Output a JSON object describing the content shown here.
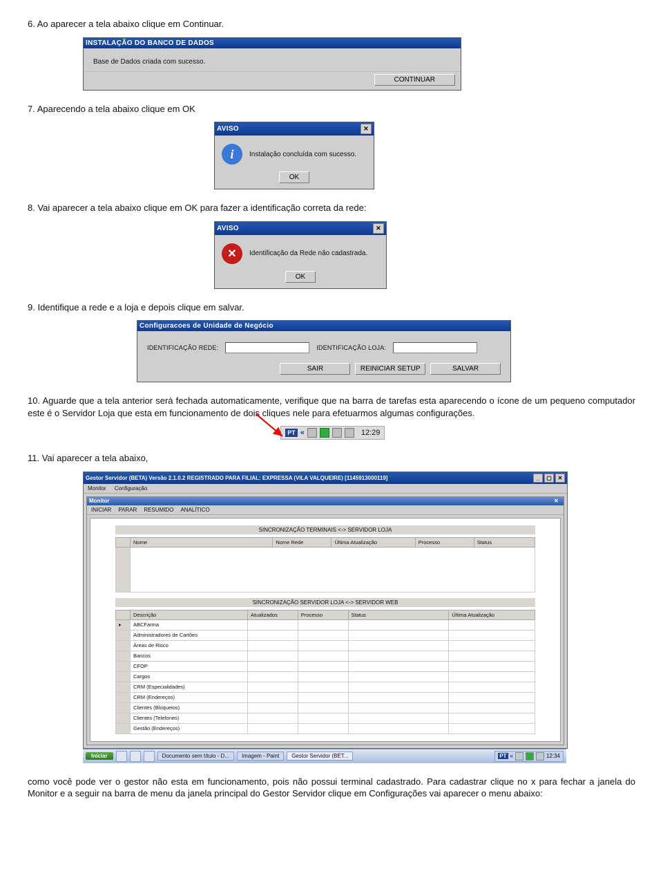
{
  "step6": {
    "text": "6. Ao aparecer a tela abaixo clique em Continuar."
  },
  "fig1": {
    "title": "INSTALAÇÃO DO BANCO DE DADOS",
    "body_text": "Base de Dados criada com sucesso.",
    "continuar_label": "CONTINUAR"
  },
  "step7": {
    "text": "7. Aparecendo a tela abaixo clique em OK"
  },
  "fig2": {
    "title": "AVISO",
    "msg": "Instalação concluída com sucesso.",
    "ok_label": "OK"
  },
  "step8": {
    "text": "8. Vai aparecer a tela abaixo clique em OK para fazer a identificação correta da rede:"
  },
  "fig3": {
    "title": "AVISO",
    "msg": "Identificação da Rede não cadastrada.",
    "ok_label": "OK"
  },
  "step9": {
    "text": "9. Identifique a rede e a loja e depois clique em salvar."
  },
  "fig4": {
    "title": "Configuracoes de Unidade de Negócio",
    "label_rede": "IDENTIFICAÇÃO REDE:",
    "label_loja": "IDENTIFICAÇÃO LOJA:",
    "btn_sair": "SAIR",
    "btn_reiniciar": "REINICIAR SETUP",
    "btn_salvar": "SALVAR"
  },
  "step10": {
    "text": "10. Aguarde que a tela anterior será fechada automaticamente, verifique que na barra de tarefas esta aparecendo o ícone de um pequeno computador este é o Servidor Loja que esta em funcionamento de dois cliques nele para efetuarmos algumas configurações."
  },
  "fig5": {
    "lang": "PT",
    "clock": "12:29"
  },
  "step11": {
    "text": "11. Vai aparecer a tela abaixo,"
  },
  "fig6": {
    "title": "Gestor Servidor (BETA) Versão 2.1.0.2 REGISTRADO PARA FILIAL: EXPRESSA (VILA VALQUEIRE) [1145913000119]",
    "menus": [
      "Monitor",
      "Configuração"
    ],
    "inner_title": "Monitor",
    "toolbar": [
      "INICIAR",
      "PARAR",
      "RESUMIDO",
      "ANALÍTICO"
    ],
    "sect1_title": "SINCRONIZAÇÃO TERMINAIS <-> SERVIDOR LOJA",
    "tbl1_headers": [
      "Nome",
      "Nome Rede",
      "Última Atualização",
      "Processo",
      "Status"
    ],
    "sect2_title": "SINCRONIZAÇÃO SERVIDOR LOJA <-> SERVIDOR WEB",
    "tbl2_headers": [
      "Descrição",
      "Atualizados",
      "Processo",
      "Status",
      "Última Atualização"
    ],
    "tbl2_rows": [
      "ABCFarma",
      "Administradores de Cartões",
      "Áreas de Risco",
      "Bancos",
      "CFOP",
      "Cargos",
      "CRM (Especialidades)",
      "CRM (Endereços)",
      "Clientes (Bloqueios)",
      "Clientes (Telefones)",
      "Gestão (Endereços)"
    ],
    "start_label": "Iniciar",
    "task_doc": "Documento sem título - D...",
    "task_paint": "Imagem - Paint",
    "task_gestor": "Gestor Servidor (BET...",
    "tray_lang": "PT",
    "tray_clock": "12:34"
  },
  "step_post": {
    "text": "como você pode ver o gestor não esta em funcionamento, pois não possui terminal cadastrado. Para cadastrar clique no x para fechar a janela do Monitor e a seguir na barra de menu da janela principal do Gestor Servidor clique em Configurações vai aparecer o menu abaixo:"
  }
}
